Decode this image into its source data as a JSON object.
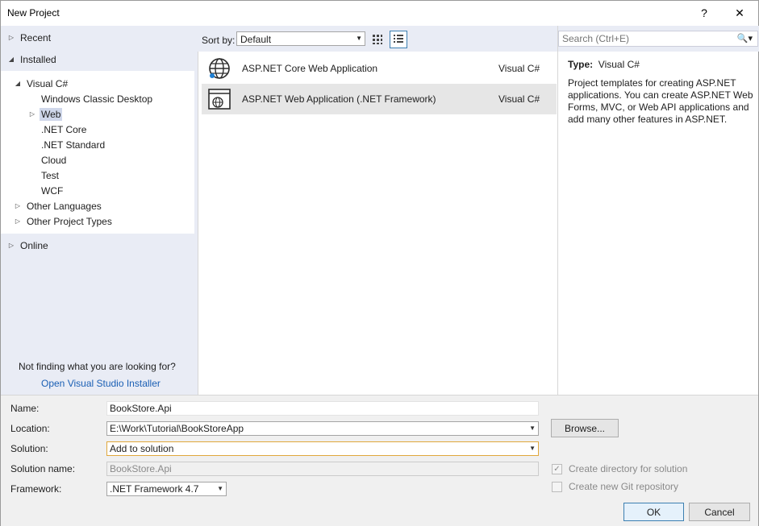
{
  "window": {
    "title": "New Project",
    "help_glyph": "?",
    "close_glyph": "✕"
  },
  "tree": {
    "recent": "Recent",
    "installed": "Installed",
    "visual_csharp": "Visual C#",
    "children": [
      "Windows Classic Desktop",
      "Web",
      ".NET Core",
      ".NET Standard",
      "Cloud",
      "Test",
      "WCF"
    ],
    "other_languages": "Other Languages",
    "other_project_types": "Other Project Types",
    "online": "Online",
    "selected": "Web"
  },
  "help": {
    "not_finding": "Not finding what you are looking for?",
    "installer_link": "Open Visual Studio Installer"
  },
  "sort": {
    "label": "Sort by:",
    "value": "Default"
  },
  "search": {
    "placeholder": "Search (Ctrl+E)"
  },
  "templates": [
    {
      "name": "ASP.NET Core Web Application",
      "lang": "Visual C#",
      "icon": "globe-icon"
    },
    {
      "name": "ASP.NET Web Application (.NET Framework)",
      "lang": "Visual C#",
      "icon": "web-app-icon"
    }
  ],
  "details": {
    "type_label": "Type:",
    "type_value": "Visual C#",
    "description": "Project templates for creating ASP.NET applications. You can create ASP.NET Web Forms, MVC, or Web API applications and add many other features in ASP.NET."
  },
  "form": {
    "name_label": "Name:",
    "name_value": "BookStore.Api",
    "location_label": "Location:",
    "location_value": "E:\\Work\\Tutorial\\BookStoreApp",
    "solution_label": "Solution:",
    "solution_value": "Add to solution",
    "solution_name_label": "Solution name:",
    "solution_name_value": "BookStore.Api",
    "framework_label": "Framework:",
    "framework_value": ".NET Framework 4.7",
    "browse": "Browse...",
    "create_dir": "Create directory for solution",
    "new_git": "Create new Git repository",
    "ok": "OK",
    "cancel": "Cancel"
  }
}
